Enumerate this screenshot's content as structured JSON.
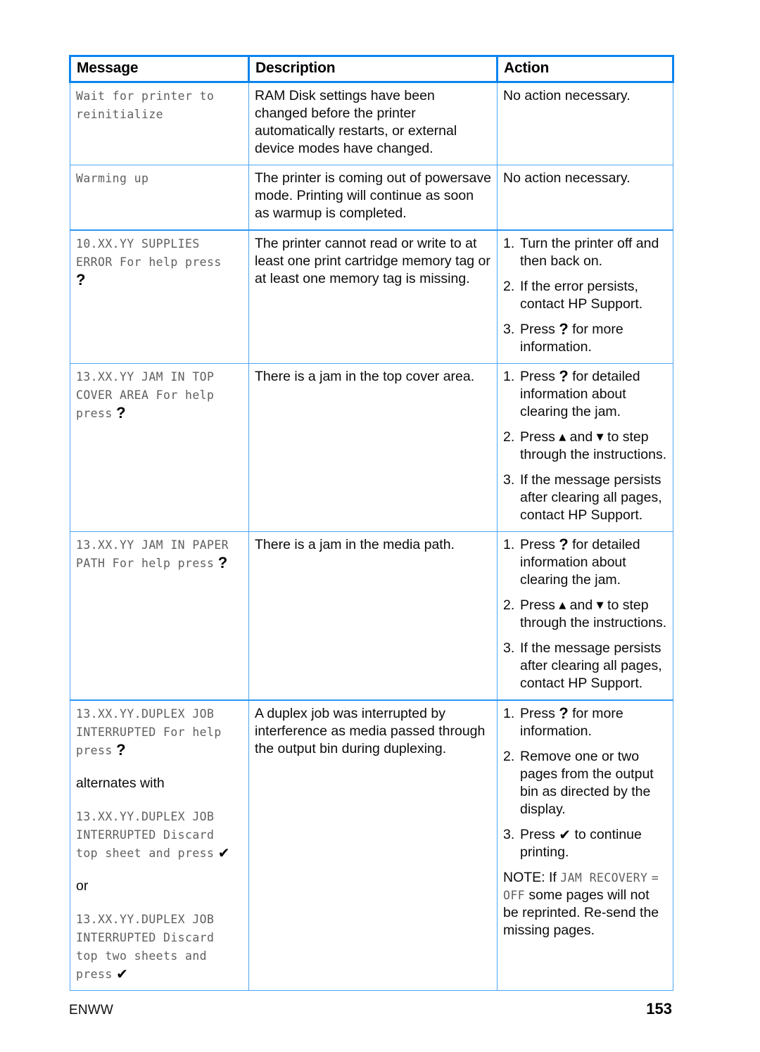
{
  "table": {
    "headers": [
      "Message",
      "Description",
      "Action"
    ],
    "rows": [
      {
        "message_lines": [
          "Wait for printer to",
          "reinitialize"
        ],
        "description": "RAM Disk settings have been changed before the printer automatically restarts, or external device modes have changed.",
        "action_plain": "No action necessary."
      },
      {
        "message_lines": [
          "Warming up"
        ],
        "description": "The printer is coming out of powersave mode. Printing will continue as soon as warmup is completed.",
        "action_plain": "No action necessary."
      },
      {
        "message_lines": [
          "10.XX.YY SUPPLIES",
          "ERROR For help press"
        ],
        "message_glyph": "?",
        "description": "The printer cannot read or write to at least one print cartridge memory tag or at least one memory tag is missing.",
        "actions": [
          {
            "num": "1.",
            "text": "Turn the printer off and then back on."
          },
          {
            "num": "2.",
            "text": "If the error persists, contact HP Support."
          },
          {
            "num": "3.",
            "pre": "Press ",
            "glyph": "?",
            "post": " for more information."
          }
        ]
      },
      {
        "message_lines": [
          "13.XX.YY JAM IN TOP",
          "COVER AREA For help",
          "press"
        ],
        "message_glyph": "?",
        "description": "There is a jam in the top cover area.",
        "actions": [
          {
            "num": "1.",
            "pre": "Press ",
            "glyph": "?",
            "post": "  for detailed information about clearing the jam."
          },
          {
            "num": "2.",
            "pre": "Press ",
            "glyph_up": "▲",
            "mid": " and ",
            "glyph_down": "▼",
            "post": " to step through the instructions."
          },
          {
            "num": "3.",
            "text": "If the message persists after clearing all pages, contact HP Support."
          }
        ]
      },
      {
        "message_lines": [
          "13.XX.YY JAM IN PAPER",
          "PATH For help press"
        ],
        "message_glyph": "?",
        "description": "There is a jam in the media path.",
        "actions": [
          {
            "num": "1.",
            "pre": "Press ",
            "glyph": "?",
            "post": " for detailed information about clearing the jam."
          },
          {
            "num": "2.",
            "pre": "Press ",
            "glyph_up": "▲",
            "mid": " and ",
            "glyph_down": "▼",
            "post": " to step through the instructions."
          },
          {
            "num": "3.",
            "text": "If the message persists after clearing all pages, contact HP Support."
          }
        ]
      },
      {
        "message_block_1": [
          "13.XX.YY.DUPLEX JOB",
          "INTERRUPTED For help",
          "press"
        ],
        "message_block_1_glyph": "?",
        "connector_1": "alternates with",
        "message_block_2": [
          "13.XX.YY.DUPLEX JOB",
          "INTERRUPTED Discard",
          "top sheet and press"
        ],
        "message_block_2_glyph": "✔",
        "connector_2": "or",
        "message_block_3": [
          "13.XX.YY.DUPLEX JOB",
          "INTERRUPTED Discard",
          "top two sheets and",
          "press"
        ],
        "message_block_3_glyph": "✔",
        "description": "A duplex job was interrupted by interference as media passed through the output bin during duplexing.",
        "actions": [
          {
            "num": "1.",
            "pre": "Press ",
            "glyph": "?",
            "post": " for more information."
          },
          {
            "num": "2.",
            "text": "Remove one or two pages from the output bin as directed by the display."
          },
          {
            "num": "3.",
            "pre": "Press ",
            "glyph": "✔",
            "post": " to continue printing."
          }
        ],
        "note_pre": "NOTE: If ",
        "note_lcd_1": "JAM RECOVERY",
        "note_lcd_2": "= OFF",
        "note_post": " some pages will not be reprinted. Re-send the missing pages."
      }
    ]
  },
  "footer": {
    "locale": "ENWW",
    "page_number": "153"
  },
  "colors": {
    "header_border": "#0a84ef",
    "cell_border": "#4da6f5",
    "lcd_text": "#5f5f5f",
    "body_text": "#0b0b0b"
  }
}
